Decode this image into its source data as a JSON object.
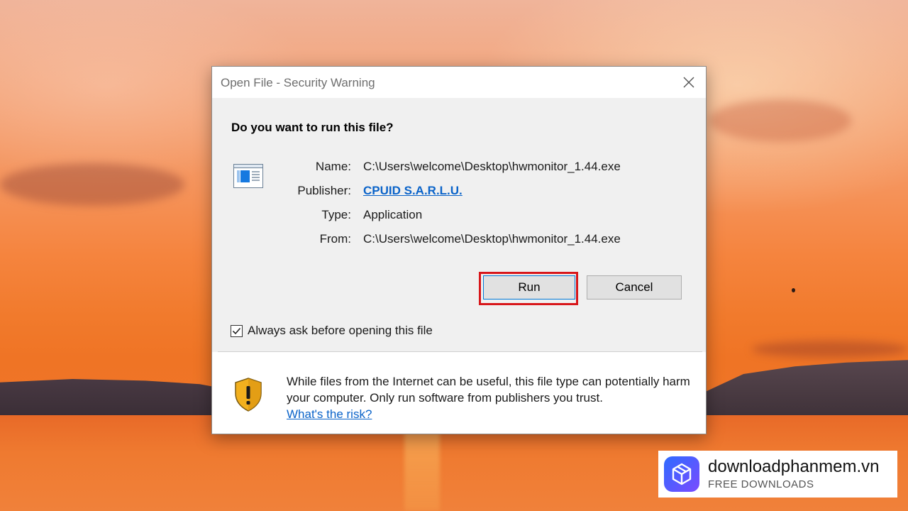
{
  "dialog": {
    "title": "Open File - Security Warning",
    "heading": "Do you want to run this file?",
    "fields": {
      "name_label": "Name:",
      "name_value": "C:\\Users\\welcome\\Desktop\\hwmonitor_1.44.exe",
      "publisher_label": "Publisher:",
      "publisher_value": "CPUID S.A.R.L.U.",
      "type_label": "Type:",
      "type_value": "Application",
      "from_label": "From:",
      "from_value": "C:\\Users\\welcome\\Desktop\\hwmonitor_1.44.exe"
    },
    "run_label": "Run",
    "cancel_label": "Cancel",
    "checkbox_label": "Always ask before opening this file",
    "checkbox_checked": true,
    "warning_text": "While files from the Internet can be useful, this file type can potentially harm your computer. Only run software from publishers you trust.",
    "risk_link": "What's the risk?"
  },
  "icons": [
    "close-icon",
    "application-file-icon",
    "warning-shield-icon",
    "check-icon",
    "cube-logo-icon"
  ],
  "colors": {
    "link": "#0a63c9",
    "highlight": "#d8161a",
    "shield_fill": "#f2b01e"
  },
  "watermark": {
    "name": "downloadphanmem.vn",
    "subtitle": "FREE DOWNLOADS"
  }
}
